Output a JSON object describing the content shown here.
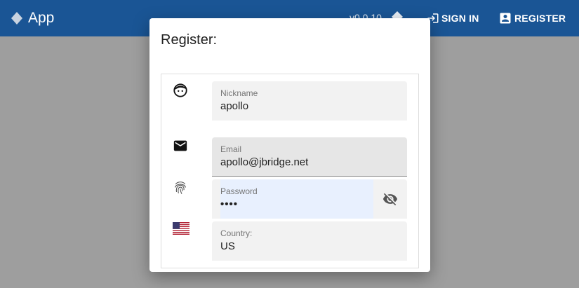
{
  "appbar": {
    "title": "App",
    "version": "v0.0.10",
    "signin_label": "SIGN IN",
    "register_label": "REGISTER",
    "color": "#1a5595"
  },
  "dialog": {
    "title": "Register:"
  },
  "form": {
    "nickname": {
      "label": "Nickname",
      "value": "apollo",
      "icon": "face-icon"
    },
    "email": {
      "label": "Email",
      "value": "apollo@jbridge.net",
      "icon": "mail-icon"
    },
    "password": {
      "label": "Password",
      "value": "••••",
      "icon": "fingerprint-icon",
      "toggle_icon": "visibility-off-icon"
    },
    "country": {
      "label": "Country:",
      "value": "US",
      "icon": "us-flag-icon"
    }
  }
}
